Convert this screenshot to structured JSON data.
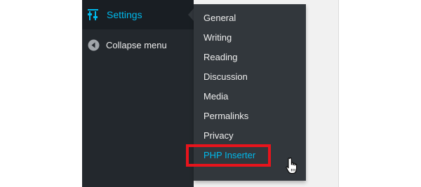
{
  "sidebar": {
    "settings_label": "Settings",
    "collapse_label": "Collapse menu"
  },
  "submenu": {
    "items": [
      {
        "label": "General"
      },
      {
        "label": "Writing"
      },
      {
        "label": "Reading"
      },
      {
        "label": "Discussion"
      },
      {
        "label": "Media"
      },
      {
        "label": "Permalinks"
      },
      {
        "label": "Privacy"
      },
      {
        "label": "PHP Inserter",
        "highlighted": true
      }
    ]
  },
  "colors": {
    "sidebar_bg": "#23282d",
    "submenu_bg": "#32373c",
    "accent": "#00b9eb",
    "highlight_border": "#e8141c"
  },
  "icons": {
    "settings": "sliders-icon",
    "collapse": "collapse-arrow-icon",
    "cursor": "hand-pointer-icon"
  }
}
